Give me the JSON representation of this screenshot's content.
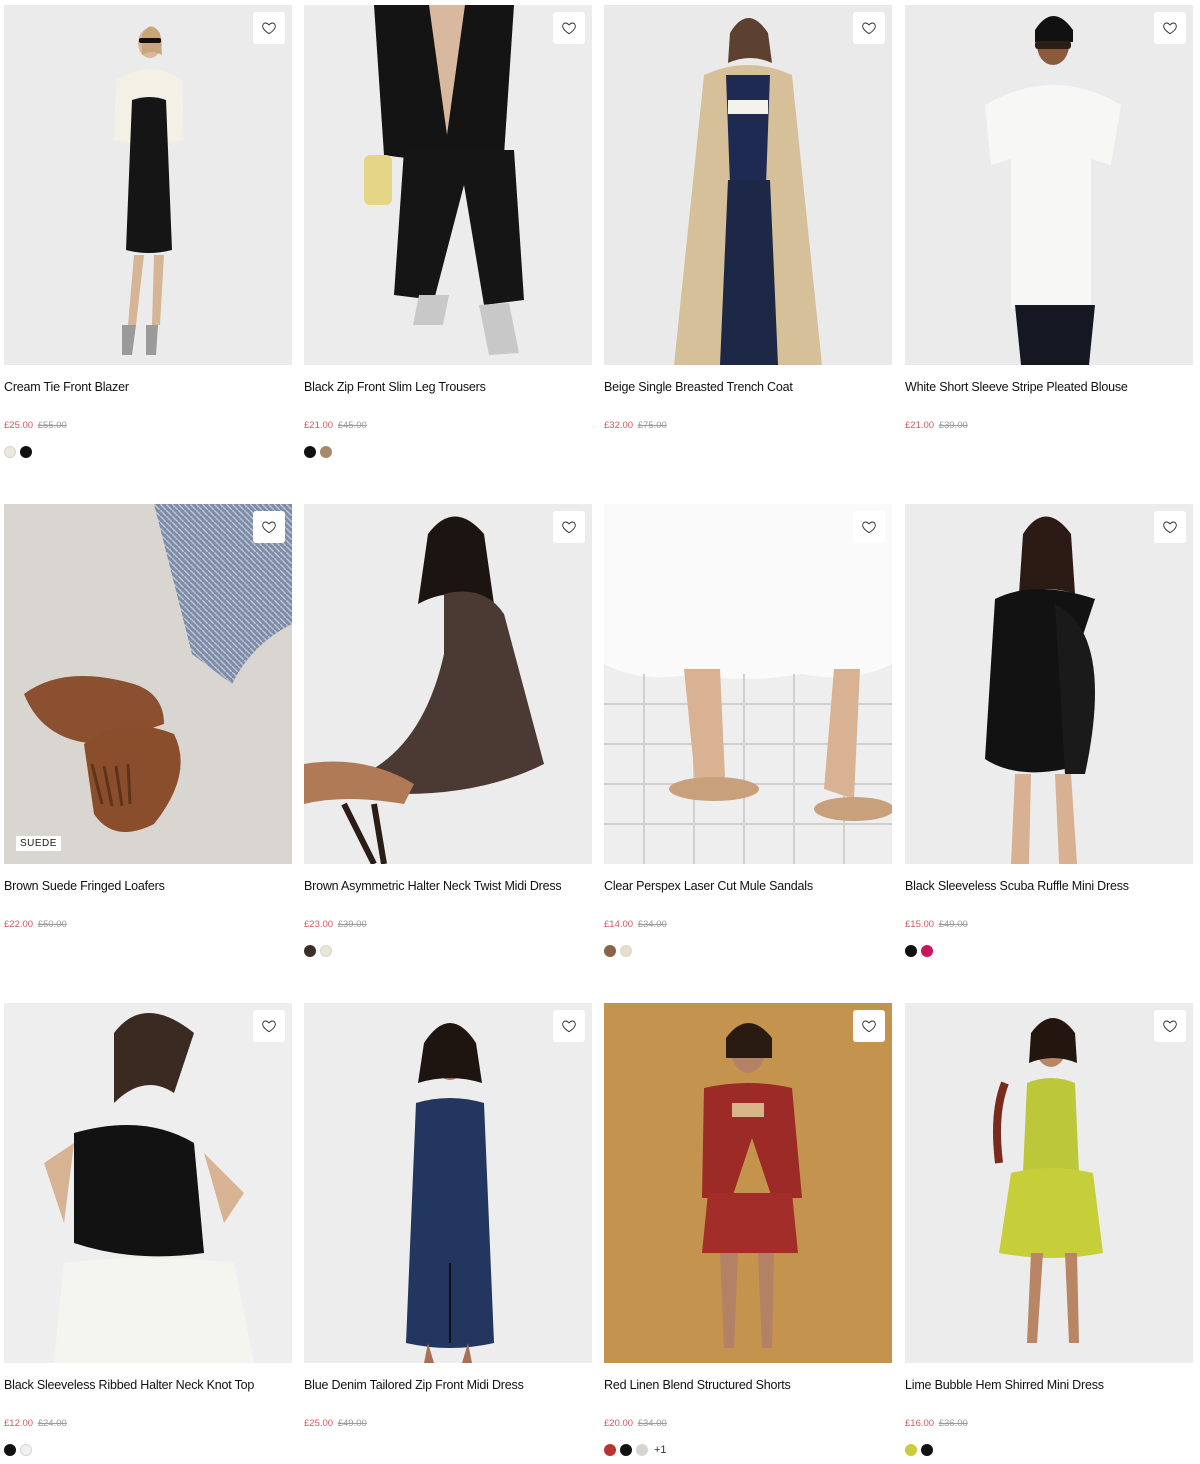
{
  "colors": {
    "sale": "#d4585f",
    "was": "#9a9a9a"
  },
  "products": [
    {
      "name": "Cream Tie Front Blazer",
      "price": "£25.00",
      "was": "£55.00",
      "swatches": [
        "#ece8dc",
        "#111111"
      ],
      "bg": "#ebebeb",
      "badge": ""
    },
    {
      "name": "Black Zip Front Slim Leg Trousers",
      "price": "£21.00",
      "was": "£45.00",
      "swatches": [
        "#111111",
        "#a88a6a"
      ],
      "bg": "#ececec",
      "badge": ""
    },
    {
      "name": "Beige Single Breasted Trench Coat",
      "price": "£32.00",
      "was": "£75.00",
      "swatches": [],
      "bg": "#eaeaea",
      "badge": ""
    },
    {
      "name": "White Short Sleeve Stripe Pleated Blouse",
      "price": "£21.00",
      "was": "£39.00",
      "swatches": [],
      "bg": "#ebebeb",
      "badge": ""
    },
    {
      "name": "Brown Suede Fringed Loafers",
      "price": "£22.00",
      "was": "£50.00",
      "swatches": [],
      "bg": "#d9d6d1",
      "badge": "SUEDE"
    },
    {
      "name": "Brown Asymmetric Halter Neck Twist Midi Dress",
      "price": "£23.00",
      "was": "£39.00",
      "swatches": [
        "#3b2e27",
        "#e9e6d2"
      ],
      "bg": "#ececec",
      "badge": ""
    },
    {
      "name": "Clear Perspex Laser Cut Mule Sandals",
      "price": "£14.00",
      "was": "£34.00",
      "swatches": [
        "#8a6248",
        "#e7dfc8"
      ],
      "bg": "#eeeeee",
      "badge": ""
    },
    {
      "name": "Black Sleeveless Scuba Ruffle Mini Dress",
      "price": "£15.00",
      "was": "£49.00",
      "swatches": [
        "#111111",
        "#c8155c"
      ],
      "bg": "#ececec",
      "badge": ""
    },
    {
      "name": "Black Sleeveless Ribbed Halter Neck Knot Top",
      "price": "£12.00",
      "was": "£24.00",
      "swatches": [
        "#111111",
        "#f0f0f0"
      ],
      "bg": "#eeeeee",
      "badge": ""
    },
    {
      "name": "Blue Denim Tailored Zip Front Midi Dress",
      "price": "£25.00",
      "was": "£49.00",
      "swatches": [],
      "bg": "#ededed",
      "badge": ""
    },
    {
      "name": "Red Linen Blend Structured Shorts",
      "price": "£20.00",
      "was": "£34.00",
      "swatches": [
        "#b8352f",
        "#111111",
        "#d8d4cc"
      ],
      "more": "+1",
      "bg": "#c4934e",
      "badge": ""
    },
    {
      "name": "Lime Bubble Hem Shirred Mini Dress",
      "price": "£16.00",
      "was": "£36.00",
      "swatches": [
        "#c6cf3a",
        "#111111"
      ],
      "bg": "#ececec",
      "badge": ""
    }
  ]
}
